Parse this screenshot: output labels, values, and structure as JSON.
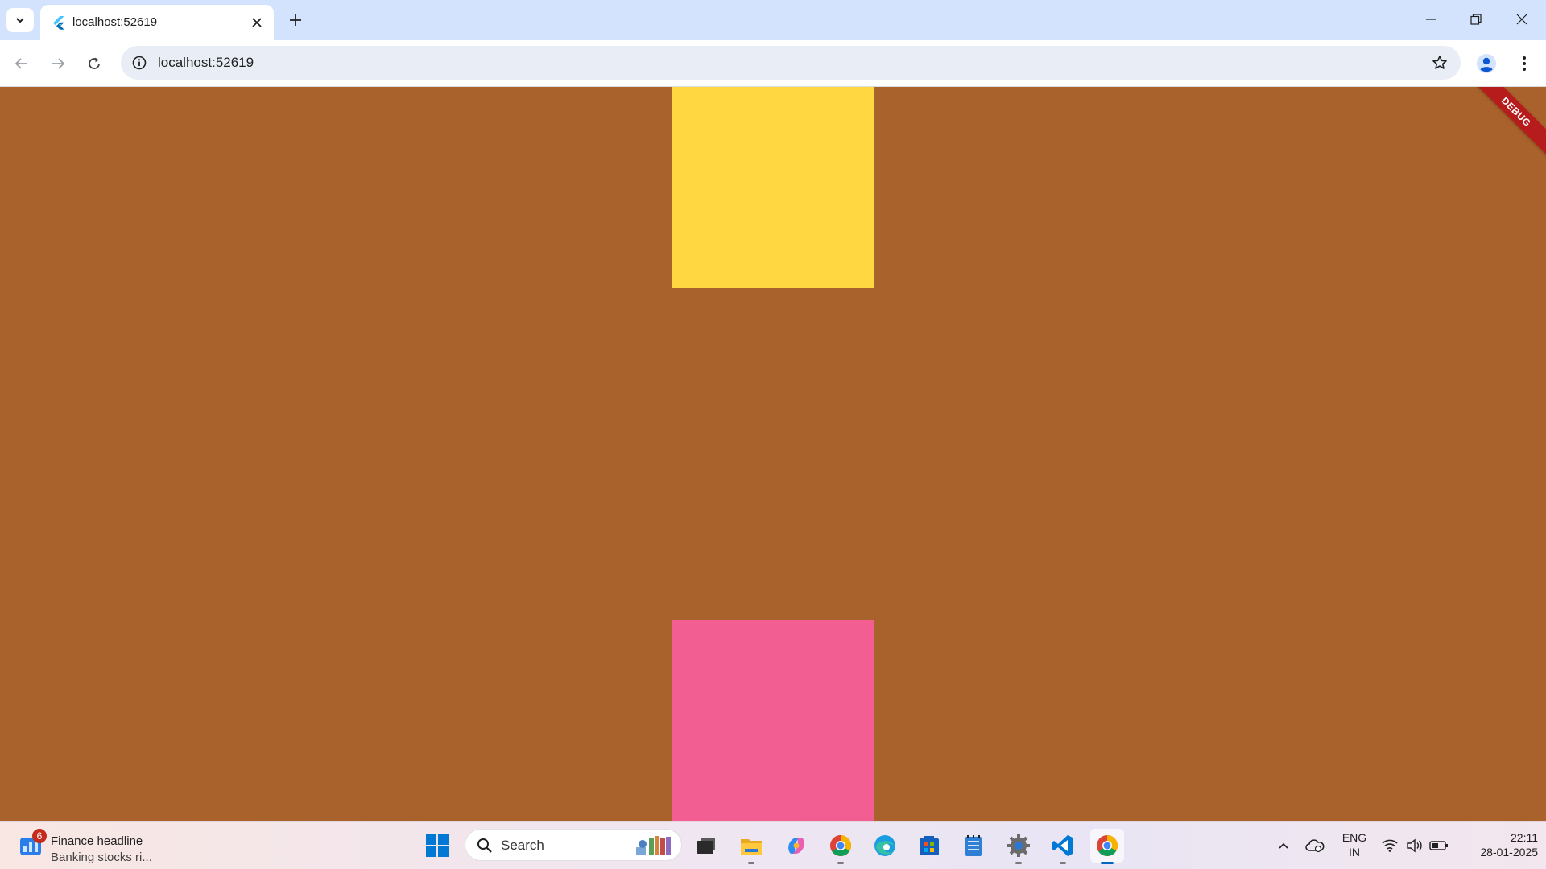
{
  "browser": {
    "tab": {
      "title": "localhost:52619"
    },
    "address_bar": {
      "url": "localhost:52619"
    }
  },
  "page": {
    "background": "#aa622c",
    "box_top_color": "#ffd740",
    "box_bottom_color": "#f25d92",
    "debug_banner": "DEBUG"
  },
  "taskbar": {
    "widget": {
      "badge": "6",
      "title": "Finance headline",
      "subtitle": "Banking stocks ri..."
    },
    "search": {
      "placeholder": "Search"
    },
    "pinned": [
      "task-view",
      "file-explorer",
      "copilot",
      "chrome",
      "edge",
      "microsoft-store",
      "notepad",
      "settings",
      "vscode",
      "chrome-active"
    ],
    "tray": {
      "lang_line1": "ENG",
      "lang_line2": "IN",
      "time": "22:11",
      "date": "28-01-2025"
    }
  }
}
